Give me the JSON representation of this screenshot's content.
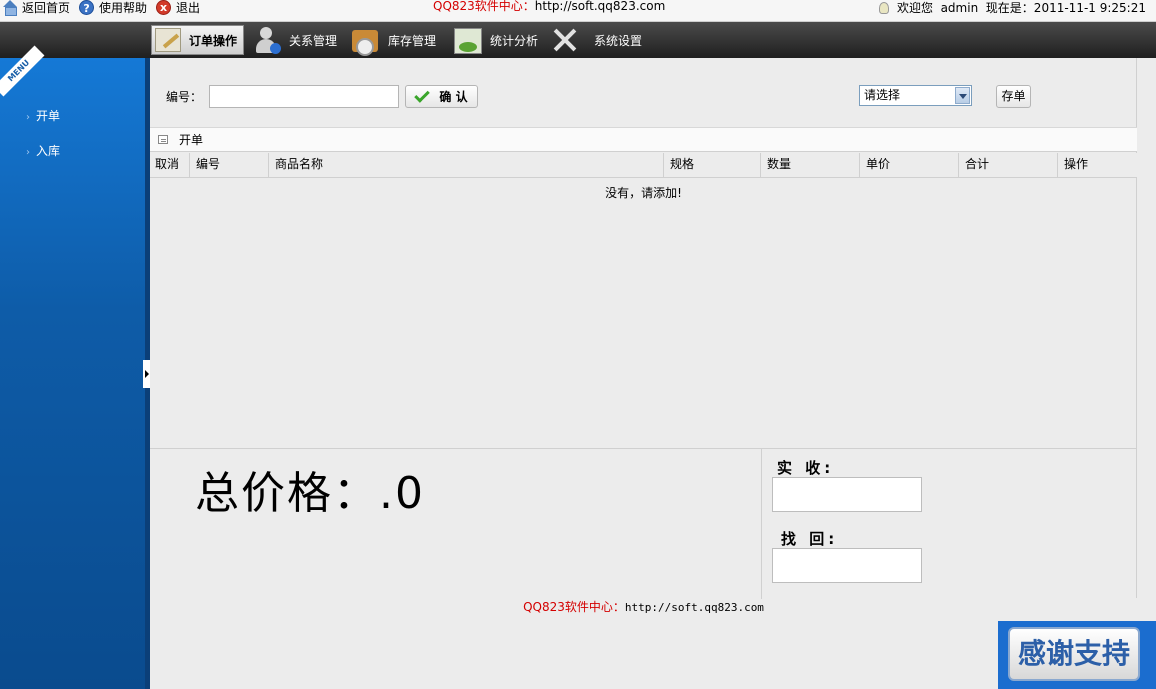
{
  "topbar": {
    "home": "返回首页",
    "help": "使用帮助",
    "help_glyph": "?",
    "exit": "退出",
    "exit_glyph": "x",
    "site_name": "QQ823软件中心：",
    "site_url": "http://soft.qq823.com",
    "welcome": "欢迎您  admin  现在是：2011-11-1 9:25:21"
  },
  "nav": {
    "items": [
      {
        "label": "订单操作",
        "icon": "edit-icon",
        "active": true
      },
      {
        "label": "关系管理",
        "icon": "user-icon"
      },
      {
        "label": "库存管理",
        "icon": "box-icon"
      },
      {
        "label": "统计分析",
        "icon": "chart-icon"
      },
      {
        "label": "系统设置",
        "icon": "tools-icon"
      }
    ]
  },
  "sidebar": {
    "ribbon": "MENU",
    "items": [
      {
        "label": "开单"
      },
      {
        "label": "入库"
      }
    ]
  },
  "toolbar": {
    "number_label": "编号：",
    "number_value": "",
    "confirm_label": "确 认",
    "select_value": "请选择",
    "save_label": "存单"
  },
  "section": {
    "title": "开单"
  },
  "table": {
    "columns": [
      "取消",
      "编号",
      "商品名称",
      "规格",
      "数量",
      "单价",
      "合计",
      "操作"
    ],
    "empty_message": "没有，请添加!"
  },
  "totals": {
    "total_label": "总价格：",
    "total_value": ".0",
    "received_label": "实 收:",
    "received_value": "",
    "change_label": "找 回:",
    "change_value": ""
  },
  "footer": {
    "site_name": "QQ823软件中心：",
    "site_url": "http://soft.qq823.com"
  },
  "badge": {
    "label": "感谢支持"
  },
  "colors": {
    "accent_red": "#d40000",
    "sidebar_blue": "#1579d6",
    "nav_dark": "#1f1f1f"
  }
}
